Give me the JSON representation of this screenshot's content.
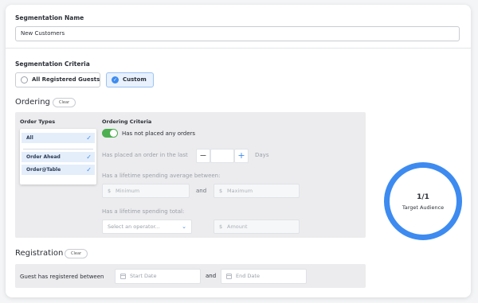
{
  "segmentation_name": {
    "label": "Segmentation Name",
    "value": "New Customers"
  },
  "segmentation_criteria": {
    "label": "Segmentation Criteria",
    "options": [
      {
        "label": "All Registered Guests",
        "selected": false
      },
      {
        "label": "Custom",
        "selected": true
      }
    ]
  },
  "ordering": {
    "title": "Ordering",
    "clear_label": "Clear",
    "order_types": {
      "label": "Order Types",
      "items": [
        {
          "label": "All",
          "checked": true
        },
        {
          "label": "Order Ahead",
          "checked": true
        },
        {
          "label": "Order@Table",
          "checked": true
        }
      ]
    },
    "criteria": {
      "label": "Ordering Criteria",
      "toggle_label": "Has not placed any orders",
      "toggle_on": true,
      "placed_order_label": "Has placed an order in the last",
      "minus": "−",
      "plus": "+",
      "days_label": "Days",
      "lifetime_avg_label": "Has a lifetime spending average between:",
      "currency": "$",
      "minimum_placeholder": "Minimum",
      "and_label": "and",
      "maximum_placeholder": "Maximum",
      "lifetime_total_label": "Has a lifetime spending total:",
      "operator_placeholder": "Select an operator...",
      "amount_placeholder": "Amount"
    }
  },
  "registration": {
    "title": "Registration",
    "clear_label": "Clear",
    "row_label": "Guest has registered between",
    "start_placeholder": "Start Date",
    "and_label": "and",
    "end_placeholder": "End Date"
  },
  "target_audience": {
    "value": "1/1",
    "label": "Target Audience"
  },
  "colors": {
    "accent": "#3d8bf0",
    "toggle_on": "#4caf50"
  }
}
